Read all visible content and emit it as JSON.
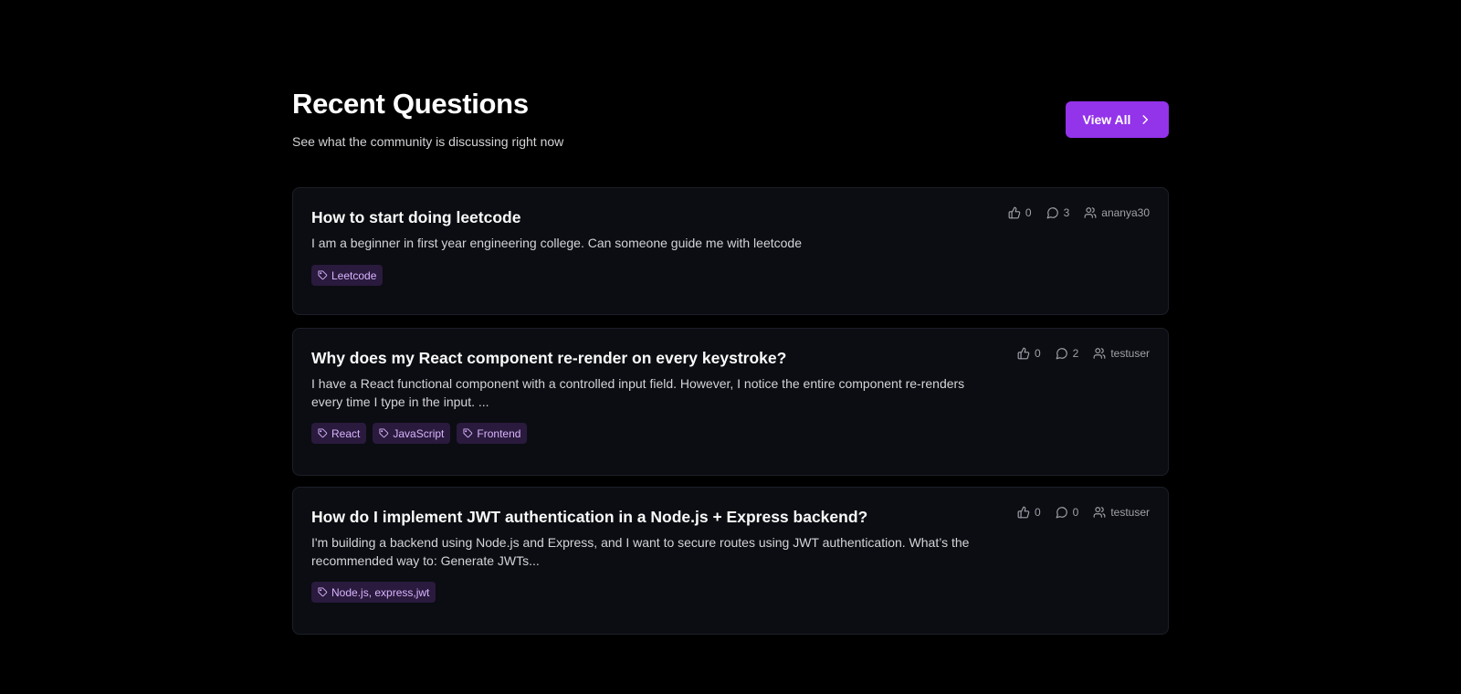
{
  "header": {
    "title": "Recent Questions",
    "subtitle": "See what the community is discussing right now",
    "view_all_label": "View All"
  },
  "colors": {
    "accent": "#9333ea",
    "background": "#000000",
    "card": "#0b0d12",
    "tag_bg": "#2a1a3d",
    "tag_text": "#d8b4fe"
  },
  "questions": [
    {
      "title": "How to start doing leetcode",
      "description": "I am a beginner in first year engineering college. Can someone guide me with leetcode",
      "tags": [
        "Leetcode"
      ],
      "likes": "0",
      "comments": "3",
      "author": "ananya30"
    },
    {
      "title": "Why does my React component re-render on every keystroke?",
      "description": "I have a React functional component with a controlled input field. However, I notice the entire component re-renders every time I type in the input. ...",
      "tags": [
        "React",
        "JavaScript",
        "Frontend"
      ],
      "likes": "0",
      "comments": "2",
      "author": "testuser"
    },
    {
      "title": "How do I implement JWT authentication in a Node.js + Express backend?",
      "description": "I'm building a backend using Node.js and Express, and I want to secure routes using JWT authentication. What’s the recommended way to: Generate JWTs...",
      "tags": [
        "Node.js, express,jwt"
      ],
      "likes": "0",
      "comments": "0",
      "author": "testuser"
    }
  ],
  "icons": {
    "like": "thumbs-up-icon",
    "comment": "message-circle-icon",
    "author": "users-icon",
    "tag": "tag-icon",
    "view_all": "chevron-right-icon"
  }
}
